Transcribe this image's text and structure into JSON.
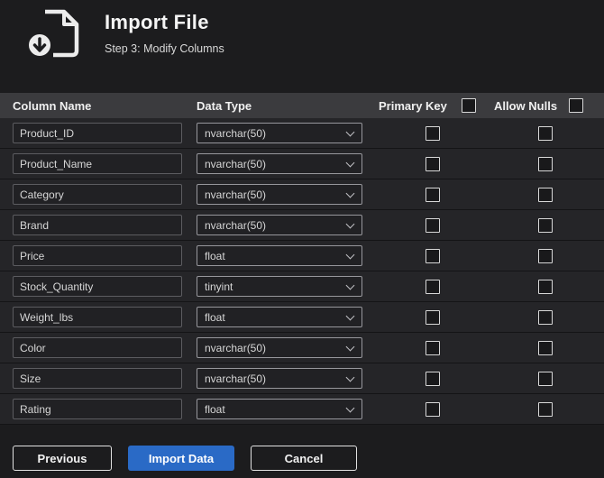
{
  "header": {
    "title": "Import File",
    "subtitle": "Step 3: Modify Columns",
    "icon": "import-file-icon"
  },
  "table": {
    "columns": {
      "name": "Column Name",
      "type": "Data Type",
      "primary_key": "Primary Key",
      "allow_nulls": "Allow Nulls"
    },
    "header_checkboxes": {
      "primary_key_checked": false,
      "allow_nulls_checked": false
    },
    "rows": [
      {
        "name": "Product_ID",
        "type": "nvarchar(50)",
        "primary_key": false,
        "allow_nulls": false
      },
      {
        "name": "Product_Name",
        "type": "nvarchar(50)",
        "primary_key": false,
        "allow_nulls": false
      },
      {
        "name": "Category",
        "type": "nvarchar(50)",
        "primary_key": false,
        "allow_nulls": false
      },
      {
        "name": "Brand",
        "type": "nvarchar(50)",
        "primary_key": false,
        "allow_nulls": false
      },
      {
        "name": "Price",
        "type": "float",
        "primary_key": false,
        "allow_nulls": false
      },
      {
        "name": "Stock_Quantity",
        "type": "tinyint",
        "primary_key": false,
        "allow_nulls": false
      },
      {
        "name": "Weight_lbs",
        "type": "float",
        "primary_key": false,
        "allow_nulls": false
      },
      {
        "name": "Color",
        "type": "nvarchar(50)",
        "primary_key": false,
        "allow_nulls": false
      },
      {
        "name": "Size",
        "type": "nvarchar(50)",
        "primary_key": false,
        "allow_nulls": false
      },
      {
        "name": "Rating",
        "type": "float",
        "primary_key": false,
        "allow_nulls": false
      }
    ]
  },
  "footer": {
    "previous": "Previous",
    "import": "Import Data",
    "cancel": "Cancel"
  },
  "colors": {
    "accent": "#2a6ac6",
    "background": "#1c1c1e",
    "table_header": "#3b3b3e"
  }
}
